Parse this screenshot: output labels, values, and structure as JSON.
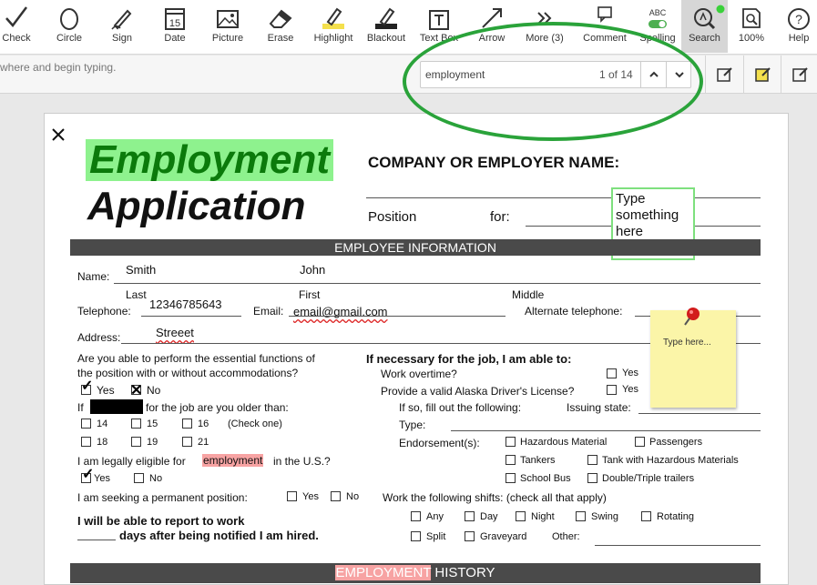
{
  "toolbar": {
    "tools": [
      {
        "name": "check",
        "label": "Check",
        "icon": "checkmark-icon"
      },
      {
        "name": "circle",
        "label": "Circle",
        "icon": "circle-icon"
      },
      {
        "name": "sign",
        "label": "Sign",
        "icon": "pen-sign-icon"
      },
      {
        "name": "date",
        "label": "Date",
        "icon": "calendar-icon",
        "date_number": "15"
      },
      {
        "name": "picture",
        "label": "Picture",
        "icon": "picture-icon"
      },
      {
        "name": "erase",
        "label": "Erase",
        "icon": "eraser-icon"
      },
      {
        "name": "highlight",
        "label": "Highlight",
        "icon": "highlighter-icon"
      },
      {
        "name": "blackout",
        "label": "Blackout",
        "icon": "blackout-icon"
      },
      {
        "name": "textbox",
        "label": "Text Box",
        "icon": "text-box-icon"
      },
      {
        "name": "arrow",
        "label": "Arrow",
        "icon": "arrow-icon"
      },
      {
        "name": "more",
        "label": "More (3)",
        "icon": "double-chevron-icon"
      },
      {
        "name": "comment",
        "label": "Comment",
        "icon": "comment-icon"
      },
      {
        "name": "spelling",
        "label": "Spelling",
        "icon": "spelling-toggle-icon",
        "icon_text": "ABC"
      },
      {
        "name": "search",
        "label": "Search",
        "icon": "magnifier-icon"
      },
      {
        "name": "zoom",
        "label": "100%",
        "icon": "zoom-icon"
      },
      {
        "name": "help",
        "label": "Help",
        "icon": "help-icon"
      }
    ]
  },
  "searchbar": {
    "hint": "where and begin typing.",
    "query": "employment",
    "count": "1 of 14"
  },
  "document": {
    "title_line1": "Employment",
    "title_line2": "Application",
    "company_label": "COMPANY OR EMPLOYER NAME:",
    "position_label": "Position",
    "for_label": "for:",
    "textbox_text": "Type something here",
    "sticky_text": "Type here...",
    "section1": "EMPLOYEE INFORMATION",
    "name_label": "Name:",
    "last_value": "Smith",
    "first_value": "John",
    "last_label": "Last",
    "first_label": "First",
    "middle_label": "Middle",
    "telephone_label": "Telephone:",
    "telephone_value": "12346785643",
    "email_label": "Email:",
    "email_value": "email@gmail.com",
    "alt_phone_label": "Alternate telephone:",
    "address_label": "Address:",
    "address_value": "Streeet",
    "q_perform_1": "Are you able to perform the essential functions of",
    "q_perform_2": "the position with or without accommodations?",
    "yes": "Yes",
    "no": "No",
    "if_label": "If",
    "older_label": "for the job are you older than:",
    "age_14": "14",
    "age_15": "15",
    "age_16": "16",
    "check_one": "(Check one)",
    "age_18": "18",
    "age_19": "19",
    "age_21": "21",
    "eligible_pre": "I am legally eligible for",
    "eligible_hl": "employment",
    "eligible_post": "in the U.S.?",
    "permanent_label": "I am seeking a permanent position:",
    "report_1": "I will be able to report to work",
    "report_2": "days after being notified I am hired.",
    "if_necessary": "If necessary for the job, I am able to:",
    "overtime": "Work overtime?",
    "alaska": "Provide a valid Alaska Driver's License?",
    "if_so": "If so, fill out the following:",
    "issuing_state": "Issuing state:",
    "type_label": "Type:",
    "endorsements_label": "Endorsement(s):",
    "hazmat": "Hazardous Material",
    "passengers": "Passengers",
    "tankers": "Tankers",
    "tank_hazmat": "Tank with Hazardous Materials",
    "school_bus": "School Bus",
    "double_triple": "Double/Triple trailers",
    "shifts_label": "Work the following shifts: (check all that apply)",
    "any": "Any",
    "day": "Day",
    "night": "Night",
    "swing": "Swing",
    "rotating": "Rotating",
    "split": "Split",
    "graveyard": "Graveyard",
    "other": "Other:",
    "section2_hl": "EMPLOYMENT",
    "section2_rest": " HISTORY"
  },
  "colors": {
    "highlight_green": "#8ef28e",
    "highlight_red": "#f7a3a3",
    "annotation_green": "#2aa33a",
    "sticky_yellow": "#fbf5a8"
  }
}
